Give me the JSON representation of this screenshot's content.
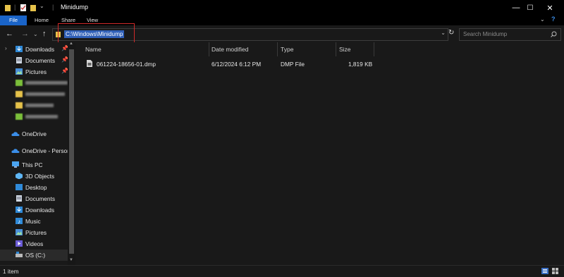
{
  "window": {
    "title": "Minidump",
    "minimize": "—",
    "maximize": "☐",
    "close": "✕"
  },
  "ribbon": {
    "tabs": [
      "File",
      "Home",
      "Share",
      "View"
    ]
  },
  "address": {
    "path": "C:\\Windows\\Minidump",
    "search_placeholder": "Search Minidump"
  },
  "nav": {
    "quick_access": [
      {
        "label": "Downloads",
        "pinned": true,
        "icon": "download-folder-icon"
      },
      {
        "label": "Documents",
        "pinned": true,
        "icon": "documents-folder-icon"
      },
      {
        "label": "Pictures",
        "pinned": true,
        "icon": "pictures-folder-icon"
      }
    ],
    "onedrive": "OneDrive",
    "onedrive_personal": "OneDrive - Person",
    "this_pc": "This PC",
    "pc_items": [
      {
        "label": "3D Objects",
        "icon": "3d-objects-icon"
      },
      {
        "label": "Desktop",
        "icon": "desktop-folder-icon"
      },
      {
        "label": "Documents",
        "icon": "documents-folder-icon"
      },
      {
        "label": "Downloads",
        "icon": "download-folder-icon"
      },
      {
        "label": "Music",
        "icon": "music-folder-icon"
      },
      {
        "label": "Pictures",
        "icon": "pictures-folder-icon"
      },
      {
        "label": "Videos",
        "icon": "videos-folder-icon"
      },
      {
        "label": "OS (C:)",
        "icon": "drive-icon"
      }
    ]
  },
  "columns": {
    "name": "Name",
    "date": "Date modified",
    "type": "Type",
    "size": "Size"
  },
  "files": [
    {
      "name": "061224-18656-01.dmp",
      "date": "6/12/2024 6:12 PM",
      "type": "DMP File",
      "size": "1,819 KB"
    }
  ],
  "status": {
    "item_count": "1 item"
  },
  "colors": {
    "accent": "#1a64c8",
    "selection": "#2f5fb7",
    "highlight_box": "#d02a2a",
    "background": "#191919"
  }
}
